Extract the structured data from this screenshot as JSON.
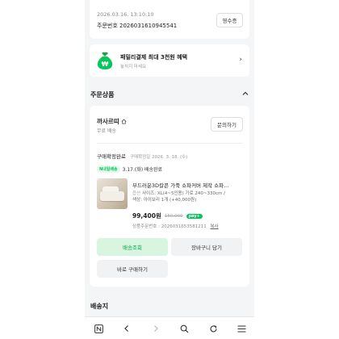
{
  "order": {
    "datetime": "2026.03.16. 13:10:10",
    "order_number": "주문번호 2026031610945541",
    "receipt_label": "영수증"
  },
  "promo": {
    "title": "패밀리결제 최대 3천원 혜택",
    "subtitle": "놓치지 마세요"
  },
  "section": {
    "title": "주문상품"
  },
  "store": {
    "name": "까사르띠",
    "shipping": "무료 배송",
    "inquiry_label": "문의하기"
  },
  "status": {
    "label": "구매확정완료",
    "date": "구매확정일 2026. 3. 18. (수)",
    "delivery_badge": "N내일배송",
    "delivery_text": "3.17.(화) 배송완료"
  },
  "product": {
    "name": "부드러운3D칼콘 가죽 쇼파커버 제작 쇼파...",
    "option_label": "옵션",
    "option_line1": "사이즈: XL(4~5인용) 가로 240~330cm /",
    "option_line2": "색상: 아이보리   1개 (+40,000원)",
    "price": "99,400원",
    "original_price": "150,000",
    "npay_badge": "pay+",
    "product_order_no": "상품주문번호 : 2026031653581211",
    "copy_label": "복사"
  },
  "buttons": {
    "track": "배송조회",
    "cart": "장바구니 담기",
    "buy_again": "바로 구매하기"
  },
  "address": {
    "title": "배송지"
  },
  "colors": {
    "accent": "#03c75a",
    "track_bg": "#d8f5df"
  }
}
